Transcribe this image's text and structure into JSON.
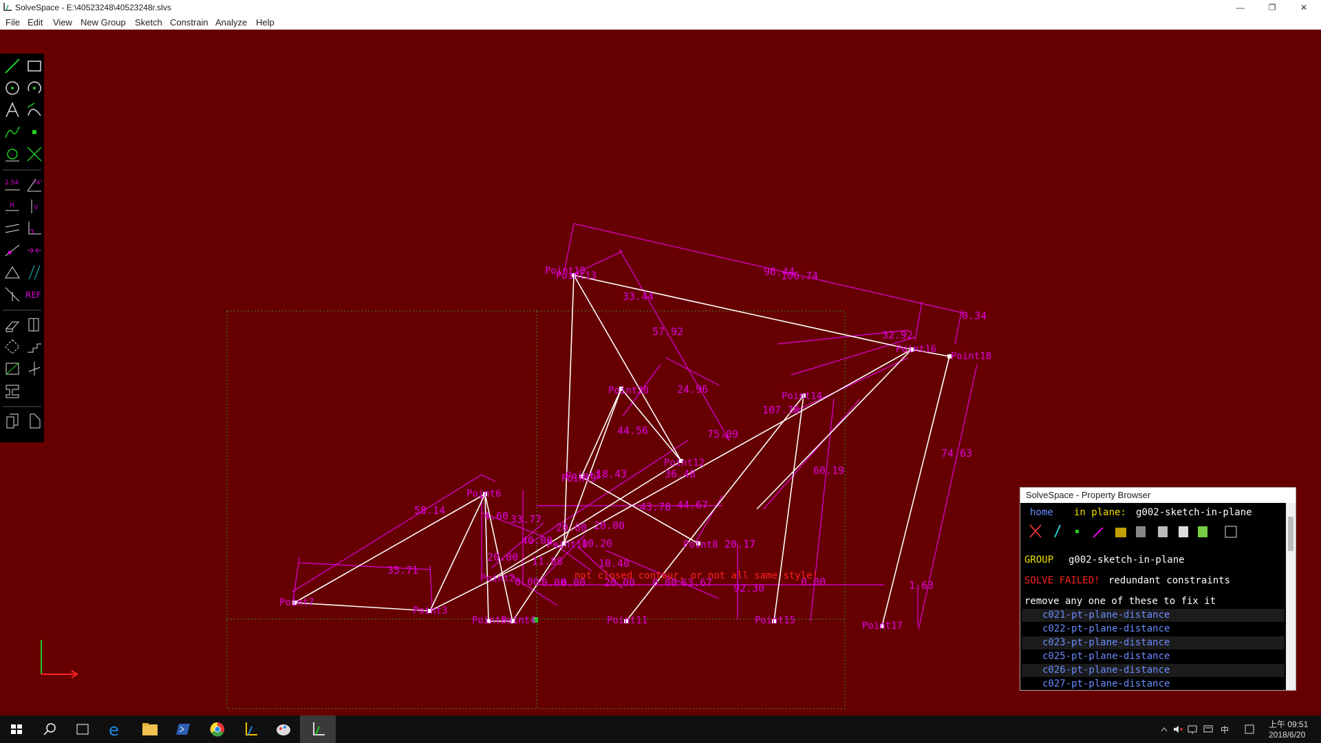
{
  "window": {
    "title": "SolveSpace - E:\\40523248\\40523248r.slvs",
    "controls": [
      "—",
      "❐",
      "✕"
    ]
  },
  "menu": [
    "File",
    "Edit",
    "View",
    "New Group",
    "Sketch",
    "Constrain",
    "Analyze",
    "Help"
  ],
  "toolbar": {
    "ref_label": "REF",
    "dim_label": "2.54",
    "angle_label": "74°",
    "horiz_label": "H",
    "vert_label": "V"
  },
  "sketch": {
    "points": [
      "Point19",
      "Point13",
      "Point16",
      "Point18",
      "Point14",
      "Point12",
      "Point8",
      "Point6",
      "Point7",
      "Point3",
      "Point5",
      "Point4",
      "Point11",
      "Point15",
      "Point17",
      "Point10",
      "Point2",
      "Point1",
      "Point20",
      "Point9"
    ],
    "dimensions": [
      "96.44",
      "106.74",
      "0.34",
      "33.44",
      "57.92",
      "32.92",
      "24.96",
      "107.70",
      "75.09",
      "44.56",
      "60.19",
      "74.63",
      "18.43",
      "36.48",
      "43.78",
      "44.67",
      "20.17",
      "58.14",
      "4.60",
      "33.77",
      "20.00",
      "40.00",
      "20.00",
      "35.71",
      "10.20",
      "10.40",
      "20.00",
      "0.00",
      "0.00",
      "63.67",
      "92.30",
      "0.00",
      "1.63",
      "20.00",
      "11.88",
      "0.00",
      "0.00"
    ],
    "error_text": "not closed contour, or not all same style!"
  },
  "property_browser": {
    "title": "SolveSpace - Property Browser",
    "home": "home",
    "in_plane_label": "in plane:",
    "in_plane_value": "g002-sketch-in-plane",
    "group_label": "GROUP",
    "group_value": "g002-sketch-in-plane",
    "solve_failed": "SOLVE FAILED!",
    "solve_reason": "redundant constraints",
    "fix_hint": "remove any one of these to fix it",
    "constraints": [
      "c021-pt-plane-distance",
      "c022-pt-plane-distance",
      "c023-pt-plane-distance",
      "c025-pt-plane-distance",
      "c026-pt-plane-distance",
      "c027-pt-plane-distance"
    ]
  },
  "taskbar": {
    "time": "上午 09:51",
    "date": "2018/6/20",
    "ime": "中"
  }
}
